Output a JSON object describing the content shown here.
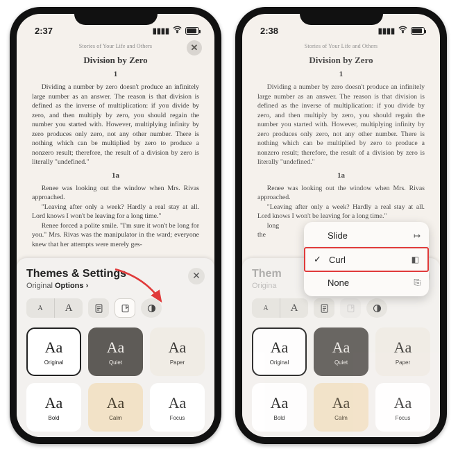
{
  "status": {
    "time_left": "2:37",
    "time_right": "2:38",
    "battery": "89"
  },
  "reader": {
    "book_title": "Stories of Your Life and Others",
    "chapter_title": "Division by Zero",
    "section1": "1",
    "para1": "Dividing a number by zero doesn't produce an infinitely large number as an answer. The reason is that division is defined as the inverse of multiplication: if you divide by zero, and then multiply by zero, you should regain the number you started with. However, multiplying infinity by zero produces only zero, not any other number. There is nothing which can be multiplied by zero to produce a nonzero result; therefore, the result of a division by zero is literally \"undefined.\"",
    "section2": "1a",
    "para2": "Renee was looking out the window when Mrs. Rivas approached.",
    "para3": "\"Leaving after only a week? Hardly a real stay at all. Lord knows I won't be leaving for a long time.\"",
    "para4": "Renee forced a polite smile. \"I'm sure it won't be long for you.\" Mrs. Rivas was the manipulator in the ward; everyone knew that her attempts were merely ges-",
    "para4_trunc": "long                                                                                                       'll be\nthe                                                                                                           ges-"
  },
  "sheet": {
    "title": "Themes & Settings",
    "subtitle_prefix": "Original ",
    "subtitle_link": "Options",
    "subtitle_chev": "›",
    "font_small": "A",
    "font_large": "A"
  },
  "themes": [
    {
      "id": "original",
      "label": "Original",
      "bg": "#ffffff",
      "fg": "#222222",
      "border": "#222222"
    },
    {
      "id": "quiet",
      "label": "Quiet",
      "bg": "#5e5b57",
      "fg": "#efece8",
      "border": "transparent"
    },
    {
      "id": "paper",
      "label": "Paper",
      "bg": "#f0ece5",
      "fg": "#3c3a37",
      "border": "transparent"
    },
    {
      "id": "bold",
      "label": "Bold",
      "bg": "#ffffff",
      "fg": "#222222",
      "border": "transparent"
    },
    {
      "id": "calm",
      "label": "Calm",
      "bg": "#f2e2c7",
      "fg": "#4a4130",
      "border": "transparent"
    },
    {
      "id": "focus",
      "label": "Focus",
      "bg": "#ffffff",
      "fg": "#3b3b3b",
      "border": "transparent"
    }
  ],
  "theme_aa": "Aa",
  "popover": {
    "items": [
      {
        "label": "Slide",
        "checked": false,
        "icon": "↦"
      },
      {
        "label": "Curl",
        "checked": true,
        "icon": "◧",
        "highlight": true
      },
      {
        "label": "None",
        "checked": false,
        "icon": "⎘"
      }
    ]
  },
  "annotation": {
    "arrow_color": "#e03a3a"
  }
}
